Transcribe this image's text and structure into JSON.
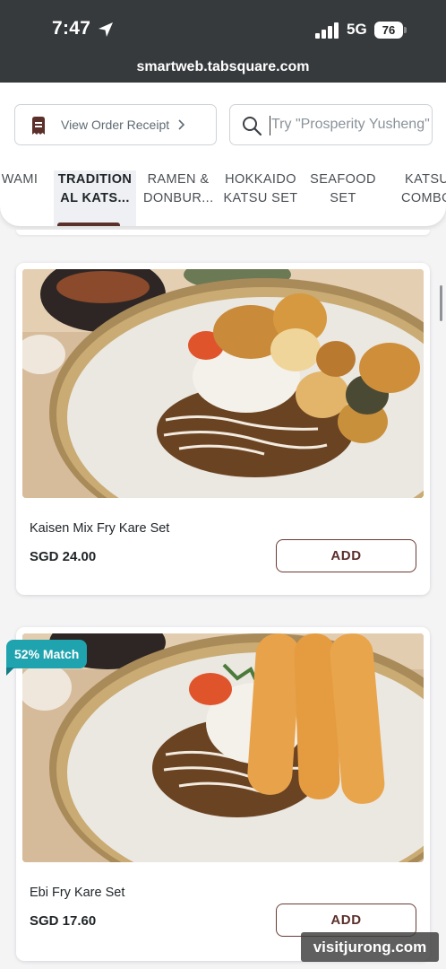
{
  "status_bar": {
    "time": "7:47",
    "network": "5G",
    "battery": "76"
  },
  "browser": {
    "url": "smartweb.tabsquare.com"
  },
  "header": {
    "receipt_label": "View Order Receipt",
    "search_placeholder": "Try \"Prosperity Yusheng\""
  },
  "tabs": [
    {
      "line1": "WAMI",
      "line2": ""
    },
    {
      "line1": "TRADITION",
      "line2": "AL KATS...",
      "active": true
    },
    {
      "line1": "RAMEN &",
      "line2": "DONBUR..."
    },
    {
      "line1": "HOKKAIDO",
      "line2": "KATSU SET"
    },
    {
      "line1": "SEAFOOD",
      "line2": "SET"
    },
    {
      "line1": "KATSU",
      "line2": "COMBO"
    }
  ],
  "products": [
    {
      "name": "Kaisen Mix Fry Kare Set",
      "price": "SGD 24.00",
      "add_label": "ADD"
    },
    {
      "name": "Ebi Fry Kare Set",
      "price": "SGD 17.60",
      "add_label": "ADD",
      "badge": "52% Match"
    }
  ],
  "watermark": "visitjurong.com",
  "colors": {
    "brand": "#5b2f2a",
    "badge": "#1fa3ae",
    "status_bar": "#363a3d"
  }
}
